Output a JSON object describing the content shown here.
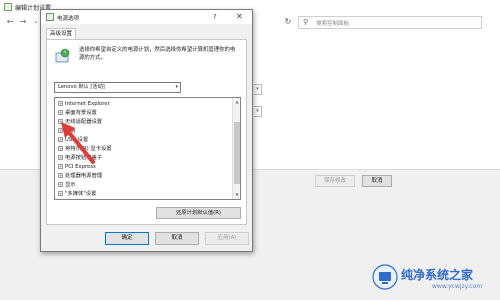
{
  "background_window": {
    "title": "编辑计划设置",
    "search_placeholder": "搜索控制面板",
    "save_label": "保存修改",
    "cancel_label": "取消"
  },
  "dialog": {
    "title": "电源选项",
    "help_icon": "help-icon",
    "close_icon": "close-icon",
    "tab_label": "高级设置",
    "description": "选择你希望自定义的电源计划，然后选择你希望计算机管理你的电源的方式。",
    "plan_selected": "Lenovo 默认 [活动]",
    "tree_items": [
      {
        "label": "Internet Explorer"
      },
      {
        "label": "桌面背景设置"
      },
      {
        "label": "无线适配器设置"
      },
      {
        "label": "睡眠"
      },
      {
        "label": "USB 设置"
      },
      {
        "label": "英特尔(R) 显卡设置"
      },
      {
        "label": "电源按钮和盖子"
      },
      {
        "label": "PCI Express"
      },
      {
        "label": "处理器电源管理"
      },
      {
        "label": "显示"
      },
      {
        "label": "\"多媒体\"设置"
      }
    ],
    "restore_label": "还原计划默认值(R)",
    "ok_label": "确定",
    "cancel_label": "取消",
    "apply_label": "应用(A)"
  },
  "watermark": {
    "text": "纯净系统之家",
    "url": "www.ycwjzy.com"
  },
  "colors": {
    "accent": "#0078d7",
    "arrow": "#e53935",
    "watermark": "#2f6bd0"
  }
}
